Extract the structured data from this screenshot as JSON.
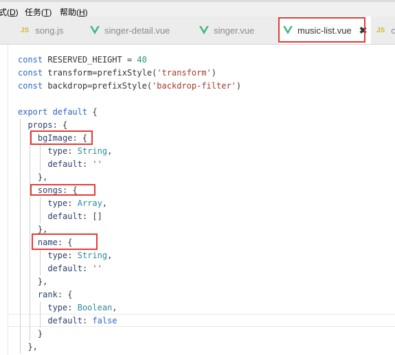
{
  "menu": {
    "items": [
      {
        "label": "式(",
        "accel": "D",
        "tail": ")"
      },
      {
        "label": "任务(",
        "accel": "T",
        "tail": ")"
      },
      {
        "label": "帮助(",
        "accel": "H",
        "tail": ")"
      }
    ]
  },
  "tabs": [
    {
      "label": "song.js",
      "icon": "JS"
    },
    {
      "label": "singer-detail.vue",
      "icon": "vue"
    },
    {
      "label": "singer.vue",
      "icon": "vue"
    },
    {
      "label": "music-list.vue",
      "icon": "vue",
      "active": true,
      "close": "✖"
    },
    {
      "label": "co",
      "icon": "JS"
    }
  ],
  "code": {
    "l1": {
      "a": "const ",
      "b": "RESERVED_HEIGHT = ",
      "c": "40"
    },
    "l2": {
      "a": "const ",
      "b": "transform=prefixStyle(",
      "c": "'transform'",
      "d": ")"
    },
    "l3": {
      "a": "const ",
      "b": "backdrop=prefixStyle(",
      "c": "'backdrop-filter'",
      "d": ")"
    },
    "l5": {
      "a": "export default",
      "b": " {"
    },
    "l6": {
      "a": "props",
      "b": ": {"
    },
    "l7": {
      "a": "bgImage",
      "b": ": {"
    },
    "l8": {
      "a": "type",
      "b": ": ",
      "c": "String",
      "d": ","
    },
    "l9": {
      "a": "default",
      "b": ": ",
      "c": "''"
    },
    "l10": {
      "a": "},"
    },
    "l11": {
      "a": "songs",
      "b": ": {"
    },
    "l12": {
      "a": "type",
      "b": ": ",
      "c": "Array",
      "d": ","
    },
    "l13": {
      "a": "default",
      "b": ": []"
    },
    "l14": {
      "a": "},"
    },
    "l15": {
      "a": "name",
      "b": ": {"
    },
    "l16": {
      "a": "type",
      "b": ": ",
      "c": "String",
      "d": ","
    },
    "l17": {
      "a": "default",
      "b": ": ",
      "c": "''"
    },
    "l18": {
      "a": "},"
    },
    "l19": {
      "a": "rank",
      "b": ": {"
    },
    "l20": {
      "a": "type",
      "b": ": ",
      "c": "Boolean",
      "d": ","
    },
    "l21": {
      "a": "default",
      "b": ": ",
      "c": "false"
    },
    "l22": {
      "a": "}"
    },
    "l23": {
      "a": "},"
    }
  },
  "colors": {
    "highlight_box": "#e53935",
    "vue_green": "#41b883",
    "js_yellow": "#d4b830"
  }
}
